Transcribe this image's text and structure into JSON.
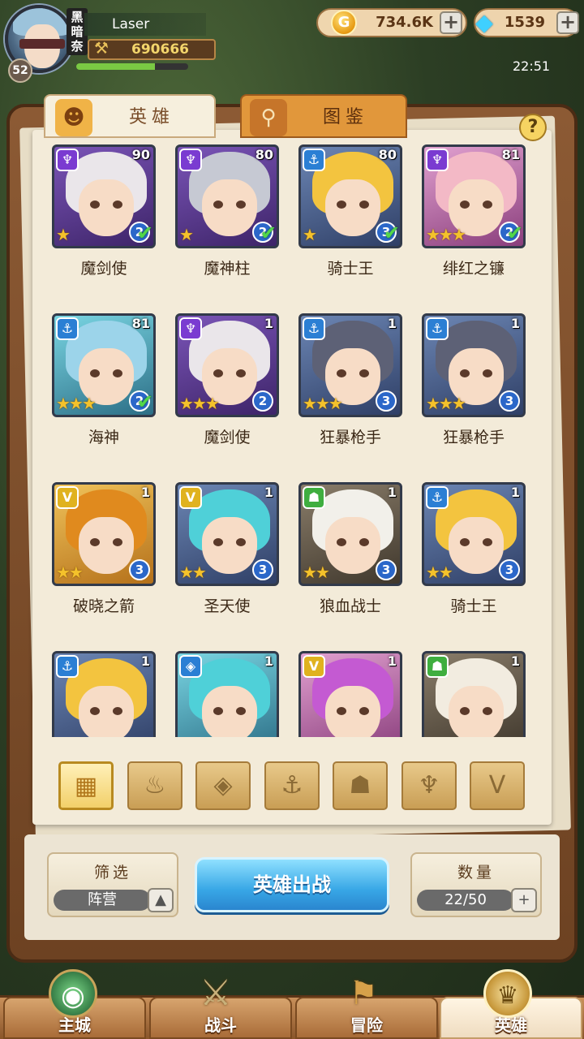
{
  "player": {
    "name": "Laser",
    "level": "52",
    "rank_tag": "黑暗奈",
    "power": "690666",
    "exp_progress": 0.7
  },
  "resources": {
    "gold": "734.6K",
    "gems": "1539"
  },
  "clock": "22:51",
  "tabs": [
    {
      "label": "英雄",
      "icon": "helmet-icon"
    },
    {
      "label": "图鉴",
      "icon": "magnifier-icon"
    }
  ],
  "help_label": "?",
  "heroes": [
    {
      "name": "魔剑使",
      "level": "90",
      "faction": "demon",
      "stars": "★",
      "grade": "2",
      "deployed": true,
      "color": "purple",
      "hair": "#eae6ea"
    },
    {
      "name": "魔神柱",
      "level": "80",
      "faction": "demon",
      "stars": "★",
      "grade": "2",
      "deployed": true,
      "color": "purple",
      "hair": "#c6c9d3"
    },
    {
      "name": "骑士王",
      "level": "80",
      "faction": "anchor",
      "stars": "★",
      "grade": "3",
      "deployed": true,
      "color": "blue",
      "hair": "#f3c43f"
    },
    {
      "name": "绯红之镰",
      "level": "81",
      "faction": "demon",
      "stars": "★★★",
      "grade": "2",
      "deployed": true,
      "color": "pink",
      "hair": "#f3b9c6"
    },
    {
      "name": "海神",
      "level": "81",
      "faction": "anchor",
      "stars": "★★★",
      "grade": "2",
      "deployed": true,
      "color": "teal",
      "hair": "#9cd4ea"
    },
    {
      "name": "魔剑使",
      "level": "1",
      "faction": "demon",
      "stars": "★★★",
      "grade": "2",
      "deployed": false,
      "color": "purple",
      "hair": "#eae6ea"
    },
    {
      "name": "狂暴枪手",
      "level": "1",
      "faction": "anchor",
      "stars": "★★★",
      "grade": "3",
      "deployed": false,
      "color": "blue",
      "hair": "#5d6176"
    },
    {
      "name": "狂暴枪手",
      "level": "1",
      "faction": "anchor",
      "stars": "★★★",
      "grade": "3",
      "deployed": false,
      "color": "blue",
      "hair": "#5d6176"
    },
    {
      "name": "破晓之箭",
      "level": "1",
      "faction": "wing",
      "stars": "★★",
      "grade": "3",
      "deployed": false,
      "color": "gold",
      "hair": "#e08a1e"
    },
    {
      "name": "圣天使",
      "level": "1",
      "faction": "wing",
      "stars": "★★",
      "grade": "3",
      "deployed": false,
      "color": "blue",
      "hair": "#4fd0d8"
    },
    {
      "name": "狼血战士",
      "level": "1",
      "faction": "beast",
      "stars": "★★",
      "grade": "3",
      "deployed": false,
      "color": "green",
      "hair": "#f2f0ea"
    },
    {
      "name": "骑士王",
      "level": "1",
      "faction": "anchor",
      "stars": "★★",
      "grade": "3",
      "deployed": false,
      "color": "blue",
      "hair": "#f3c43f"
    },
    {
      "name": "",
      "level": "1",
      "faction": "anchor",
      "stars": "",
      "grade": "",
      "deployed": false,
      "color": "blue",
      "hair": "#f3c43f"
    },
    {
      "name": "",
      "level": "1",
      "faction": "crystal",
      "stars": "",
      "grade": "",
      "deployed": false,
      "color": "teal",
      "hair": "#4fd0d8"
    },
    {
      "name": "",
      "level": "1",
      "faction": "wing",
      "stars": "",
      "grade": "",
      "deployed": false,
      "color": "pink",
      "hair": "#c45ad2"
    },
    {
      "name": "",
      "level": "1",
      "faction": "beast",
      "stars": "",
      "grade": "",
      "deployed": false,
      "color": "green",
      "hair": "#f2ece0"
    }
  ],
  "faction_glyphs": {
    "demon": "♆",
    "anchor": "⚓",
    "wing": "V",
    "beast": "☗",
    "crystal": "◈"
  },
  "filter_buttons": [
    {
      "icon": "grid-all-icon",
      "glyph": "▦",
      "active": true
    },
    {
      "icon": "flame-faction-icon",
      "glyph": "♨",
      "active": false
    },
    {
      "icon": "crystal-faction-icon",
      "glyph": "◈",
      "active": false
    },
    {
      "icon": "anchor-faction-icon",
      "glyph": "⚓",
      "active": false
    },
    {
      "icon": "beast-faction-icon",
      "glyph": "☗",
      "active": false
    },
    {
      "icon": "demon-faction-icon",
      "glyph": "♆",
      "active": false
    },
    {
      "icon": "wing-faction-icon",
      "glyph": "V",
      "active": false
    }
  ],
  "filter_box": {
    "title": "筛选",
    "value": "阵营",
    "arrow": "▲"
  },
  "deploy_label": "英雄出战",
  "count_box": {
    "title": "数量",
    "value": "22/50",
    "plus": "+"
  },
  "nav": [
    {
      "label": "主城",
      "glyph": "◉"
    },
    {
      "label": "战斗",
      "glyph": "⚔"
    },
    {
      "label": "冒险",
      "glyph": "⚑"
    },
    {
      "label": "英雄",
      "glyph": "♛"
    }
  ],
  "plus_glyph": "+",
  "coin_glyph": "G",
  "gem_glyph": "◆",
  "power_glyph": "⚒"
}
